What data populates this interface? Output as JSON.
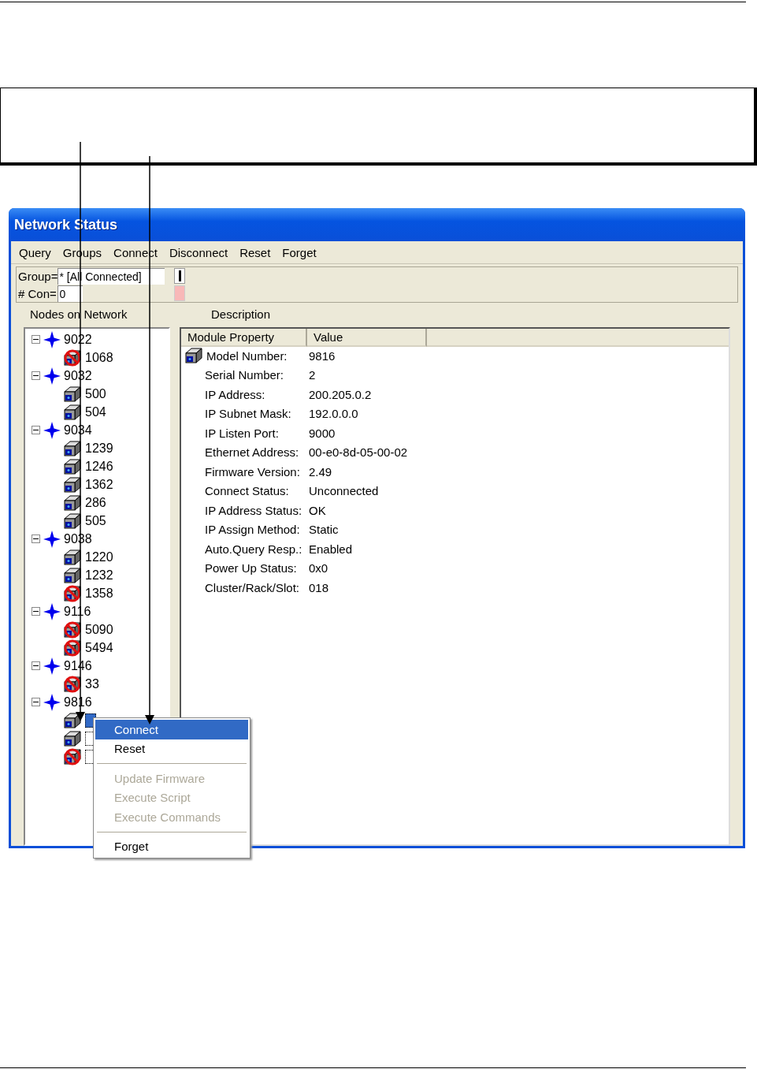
{
  "window": {
    "title": "Network Status"
  },
  "menu_bar": [
    "Query",
    "Groups",
    "Connect",
    "Disconnect",
    "Reset",
    "Forget"
  ],
  "toolbar": {
    "group_label": "Group=",
    "group_value": "* [All Connected]",
    "count_label": "# Con=",
    "count_value": "0"
  },
  "tree": {
    "heading": "Nodes on Network",
    "nodes": [
      {
        "label": "9022",
        "expanded": true,
        "children": [
          {
            "label": "1068",
            "kind": "error",
            "selected": false
          }
        ]
      },
      {
        "label": "9032",
        "expanded": true,
        "children": [
          {
            "label": "500",
            "kind": "ok",
            "selected": false
          },
          {
            "label": "504",
            "kind": "ok",
            "selected": false
          }
        ]
      },
      {
        "label": "9034",
        "expanded": true,
        "children": [
          {
            "label": "1239",
            "kind": "ok",
            "selected": false
          },
          {
            "label": "1246",
            "kind": "ok",
            "selected": false
          },
          {
            "label": "1362",
            "kind": "ok",
            "selected": false
          },
          {
            "label": "286",
            "kind": "ok",
            "selected": false
          },
          {
            "label": "505",
            "kind": "ok",
            "selected": false
          }
        ]
      },
      {
        "label": "9038",
        "expanded": true,
        "children": [
          {
            "label": "1220",
            "kind": "ok",
            "selected": false
          },
          {
            "label": "1232",
            "kind": "ok",
            "selected": false
          },
          {
            "label": "1358",
            "kind": "error",
            "selected": false
          }
        ]
      },
      {
        "label": "9116",
        "expanded": true,
        "children": [
          {
            "label": "5090",
            "kind": "error",
            "selected": false
          },
          {
            "label": "5494",
            "kind": "error",
            "selected": false
          }
        ]
      },
      {
        "label": "9146",
        "expanded": true,
        "children": [
          {
            "label": "33",
            "kind": "error",
            "selected": false
          }
        ]
      },
      {
        "label": "9816",
        "expanded": true,
        "children": [
          {
            "kind": "ok",
            "selected": true
          },
          {
            "kind": "ok",
            "selected": false
          },
          {
            "kind": "error",
            "selected": false
          }
        ]
      }
    ]
  },
  "description": {
    "heading": "Description",
    "columns": [
      "Module Property",
      "Value"
    ],
    "rows": [
      {
        "property": "Model Number:",
        "value": "9816"
      },
      {
        "property": "Serial Number:",
        "value": "2"
      },
      {
        "property": "IP Address:",
        "value": "200.205.0.2"
      },
      {
        "property": "IP Subnet Mask:",
        "value": "192.0.0.0"
      },
      {
        "property": "IP Listen Port:",
        "value": "9000"
      },
      {
        "property": "Ethernet Address:",
        "value": "00-e0-8d-05-00-02"
      },
      {
        "property": "Firmware Version:",
        "value": "2.49"
      },
      {
        "property": "Connect Status:",
        "value": "Unconnected"
      },
      {
        "property": "IP Address Status:",
        "value": "OK"
      },
      {
        "property": "IP Assign Method:",
        "value": "Static"
      },
      {
        "property": "Auto.Query Resp.:",
        "value": "Enabled"
      },
      {
        "property": "Power Up Status:",
        "value": "0x0"
      },
      {
        "property": "Cluster/Rack/Slot:",
        "value": "018"
      }
    ]
  },
  "context_menu": [
    {
      "kind": "item",
      "label": "Connect",
      "selected": true,
      "disabled": false
    },
    {
      "kind": "item",
      "label": "Reset",
      "selected": false,
      "disabled": false
    },
    {
      "kind": "separator"
    },
    {
      "kind": "item",
      "label": "Update Firmware",
      "selected": false,
      "disabled": true
    },
    {
      "kind": "item",
      "label": "Execute Script",
      "selected": false,
      "disabled": true
    },
    {
      "kind": "item",
      "label": "Execute Commands",
      "selected": false,
      "disabled": true
    },
    {
      "kind": "separator"
    },
    {
      "kind": "item",
      "label": "Forget",
      "selected": false,
      "disabled": false
    }
  ]
}
